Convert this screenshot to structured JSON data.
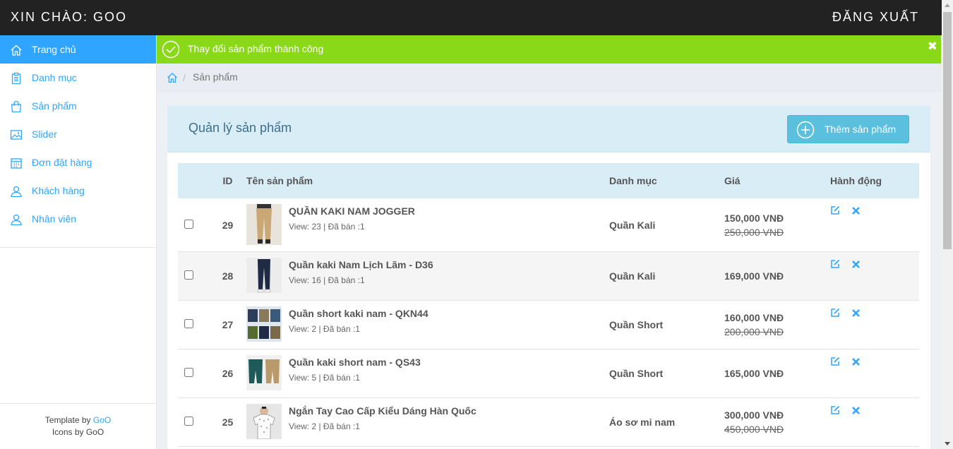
{
  "header": {
    "greeting": "XIN CHÀO: GOO",
    "logout": "ĐĂNG XUẤT"
  },
  "sidebar": {
    "items": [
      {
        "label": "Trang chủ",
        "icon": "home-icon",
        "active": true
      },
      {
        "label": "Danh mục",
        "icon": "clipboard-icon",
        "active": false
      },
      {
        "label": "Sản phẩm",
        "icon": "shopping-bag-icon",
        "active": false
      },
      {
        "label": "Slider",
        "icon": "image-icon",
        "active": false
      },
      {
        "label": "Đơn đặt hàng",
        "icon": "calendar-icon",
        "active": false
      },
      {
        "label": "Khách hàng",
        "icon": "user-icon",
        "active": false
      },
      {
        "label": "Nhân viên",
        "icon": "user-icon",
        "active": false
      }
    ],
    "credits": {
      "template_prefix": "Template by ",
      "template_link": "GoO",
      "icons": "Icons by GoO"
    }
  },
  "alert": {
    "message": "Thay đổi sản phẩm thành công",
    "close": "✖",
    "color": "#8ad919"
  },
  "breadcrumb": {
    "current": "Sản phẩm",
    "separator": "/"
  },
  "panel": {
    "title": "Quản lý sản phẩm",
    "add_button": "Thêm sản phẩm"
  },
  "table": {
    "headers": {
      "id": "ID",
      "name": "Tên sản phẩm",
      "category": "Danh mục",
      "price": "Giá",
      "action": "Hành động"
    },
    "rows": [
      {
        "id": "29",
        "name": "QUẦN KAKI NAM JOGGER",
        "meta": "View: 23 | Đã bán :1",
        "category": "Quần Kali",
        "price": "150,000 VNĐ",
        "old_price": "250,000 VNĐ",
        "thumb": "khaki-jogger"
      },
      {
        "id": "28",
        "name": "Quần kaki Nam Lịch Lãm - D36",
        "meta": "View: 16 | Đã bán :1",
        "category": "Quần Kali",
        "price": "169,000 VNĐ",
        "old_price": "",
        "thumb": "navy-pants"
      },
      {
        "id": "27",
        "name": "Quần short kaki nam - QKN44",
        "meta": "View: 2 | Đã bán :1",
        "category": "Quần Short",
        "price": "160,000 VNĐ",
        "old_price": "200,000 VNĐ",
        "thumb": "shorts-grid"
      },
      {
        "id": "26",
        "name": "Quần kaki short nam - QS43",
        "meta": "View: 5 | Đã bán :1",
        "category": "Quần Short",
        "price": "165,000 VNĐ",
        "old_price": "",
        "thumb": "shorts-pair"
      },
      {
        "id": "25",
        "name": "Ngắn Tay Cao Cấp Kiểu Dáng Hàn Quốc",
        "meta": "View: 2 | Đã bán :1",
        "category": "Áo sơ mi nam",
        "price": "300,000 VNĐ",
        "old_price": "450,000 VNĐ",
        "thumb": "shirt"
      }
    ]
  },
  "colors": {
    "accent": "#30a5ff",
    "topbar": "#222222",
    "panel_head": "#d9edf7",
    "button": "#5bc0de"
  }
}
